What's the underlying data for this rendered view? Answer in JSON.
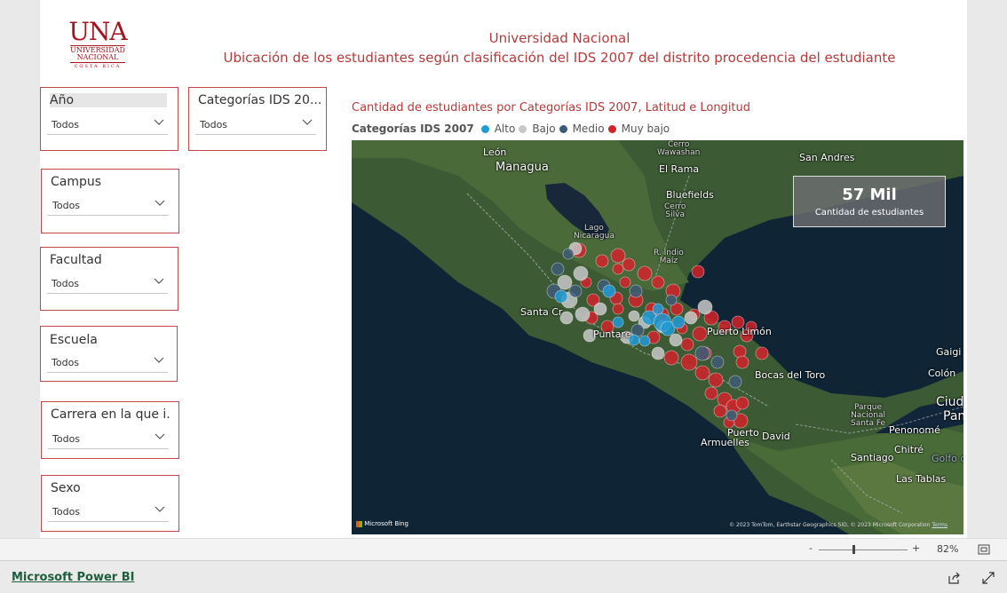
{
  "header": {
    "logo_main": "UNA",
    "logo_line1": "UNIVERSIDAD",
    "logo_line2": "NACIONAL",
    "logo_line3": "COSTA RICA",
    "title": "Universidad Nacional",
    "subtitle": "Ubicación de los estudiantes según clasificación del IDS 2007 del distrito procedencia del estudiante"
  },
  "slicers": {
    "anio": {
      "title": "Año",
      "value": "Todos"
    },
    "categorias": {
      "title": "Categorías IDS 20...",
      "value": "Todos"
    },
    "campus": {
      "title": "Campus",
      "value": "Todos"
    },
    "facultad": {
      "title": "Facultad",
      "value": "Todos"
    },
    "escuela": {
      "title": "Escuela",
      "value": "Todos"
    },
    "carrera": {
      "title": "Carrera en la que i...",
      "value": "Todos"
    },
    "sexo": {
      "title": "Sexo",
      "value": "Todos"
    }
  },
  "map_visual": {
    "title": "Cantidad de estudiantes por Categorías IDS 2007, Latitud e Longitud",
    "legend_title": "Categorías IDS 2007",
    "legend": [
      {
        "label": "Alto",
        "color": "#1f9ad6"
      },
      {
        "label": "Bajo",
        "color": "#c8c8c8"
      },
      {
        "label": "Medio",
        "color": "#3e5a78"
      },
      {
        "label": "Muy bajo",
        "color": "#d1232a"
      }
    ],
    "places": {
      "leon": "León",
      "managua": "Managua",
      "elrama": "El Rama",
      "cerro1": "Cerro",
      "cerro1b": "Wawashan",
      "bluefields": "Bluefields",
      "cerro2": "Cerro",
      "cerro2b": "Silva",
      "lago1": "Lago",
      "lago2": "Nicaragua",
      "rio1": "R. Indio",
      "rio2": "Maíz",
      "sanandres": "San Andres",
      "santacruz": "Santa Cr",
      "puntarenas": "Puntare",
      "puertolimon": "Puerto Limón",
      "bocas": "Bocas del Toro",
      "puerto": "Puerto",
      "armuelles": "Armuelles",
      "david": "David",
      "gaigi": "Gaigi",
      "colon": "Colón",
      "ciudad": "Ciuda",
      "pan": "Pan",
      "parque1": "Parque",
      "parque2": "Nacional",
      "parque3": "Santa Fe",
      "penonome": "Penonomé",
      "santiago": "Santiago",
      "chitre": "Chitré",
      "golfo": "Golfo de",
      "lastablas": "Las Tablas"
    },
    "card": {
      "value": "57 Mil",
      "label": "Cantidad de estudiantes"
    },
    "bing": "Microsoft Bing",
    "copyright": "© 2023 TomTom, Earthstar Geographics SIO, © 2023 Microsoft Corporation",
    "terms": "Terms"
  },
  "zoom": {
    "minus": "-",
    "plus": "+",
    "level": "82%"
  },
  "footer": {
    "link": "Microsoft Power BI"
  }
}
